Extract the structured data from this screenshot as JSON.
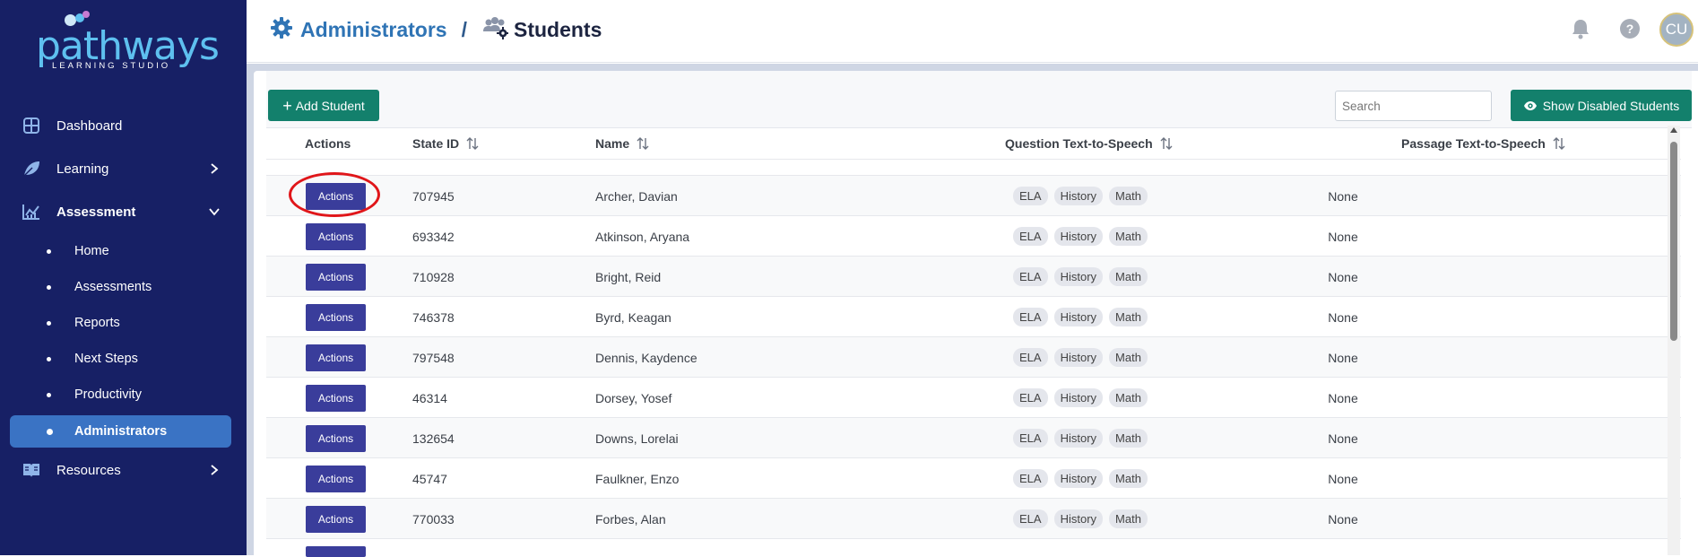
{
  "sidebar": {
    "logo": {
      "word": "pathways",
      "sub": "LEARNING STUDIO"
    },
    "nav": [
      {
        "label": "Dashboard"
      },
      {
        "label": "Learning"
      },
      {
        "label": "Assessment"
      },
      {
        "label": "Resources"
      }
    ],
    "assessment_items": [
      {
        "label": "Home"
      },
      {
        "label": "Assessments"
      },
      {
        "label": "Reports"
      },
      {
        "label": "Next Steps"
      },
      {
        "label": "Productivity"
      },
      {
        "label": "Administrators"
      }
    ]
  },
  "header": {
    "breadcrumb_parent": "Administrators",
    "breadcrumb_sep": "/",
    "breadcrumb_current": "Students",
    "avatar_initials": "CU"
  },
  "toolbar": {
    "add_student_label": "Add Student",
    "search_placeholder": "Search",
    "show_disabled_label": "Show Disabled Students"
  },
  "table": {
    "columns": {
      "actions": "Actions",
      "state_id": "State ID",
      "name": "Name",
      "question_tts": "Question Text-to-Speech",
      "passage_tts": "Passage Text-to-Speech"
    },
    "action_label": "Actions",
    "tags": [
      "ELA",
      "History",
      "Math"
    ],
    "rows": [
      {
        "state_id": "707945",
        "name": "Archer, Davian",
        "passage": "None"
      },
      {
        "state_id": "693342",
        "name": "Atkinson, Aryana",
        "passage": "None"
      },
      {
        "state_id": "710928",
        "name": "Bright, Reid",
        "passage": "None"
      },
      {
        "state_id": "746378",
        "name": "Byrd, Keagan",
        "passage": "None"
      },
      {
        "state_id": "797548",
        "name": "Dennis, Kaydence",
        "passage": "None"
      },
      {
        "state_id": "46314",
        "name": "Dorsey, Yosef",
        "passage": "None"
      },
      {
        "state_id": "132654",
        "name": "Downs, Lorelai",
        "passage": "None"
      },
      {
        "state_id": "45747",
        "name": "Faulkner, Enzo",
        "passage": "None"
      },
      {
        "state_id": "770033",
        "name": "Forbes, Alan",
        "passage": "None"
      }
    ]
  },
  "colors": {
    "sidebar_bg": "#172065",
    "active_item": "#3a73c4",
    "primary_green": "#13806c",
    "action_button": "#3a3d9b",
    "link_blue": "#2f74b5",
    "highlight_red": "#e0161a"
  }
}
